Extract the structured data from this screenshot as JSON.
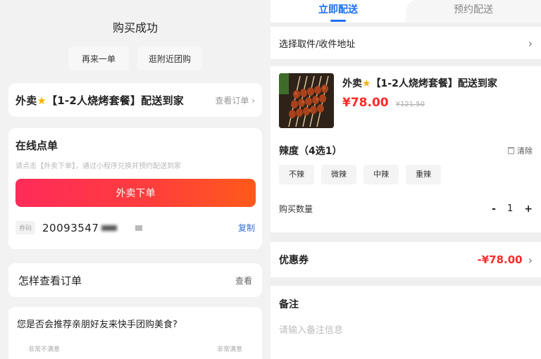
{
  "left": {
    "title": "购买成功",
    "buttons": {
      "again": "再来一单",
      "nearby": "逛附近团购"
    },
    "order": {
      "title_prefix": "外卖",
      "title_suffix": "【1-2人烧烤套餐】配送到家",
      "view_link": "查看订单 ›"
    },
    "online": {
      "title": "在线点单",
      "hint": "请点击【外卖下单】，通过小程序兑换并预约配送到家",
      "order_button": "外卖下单",
      "code_tag": "券码",
      "code_value": "20093547",
      "copy": "复制"
    },
    "howto": {
      "title": "怎样查看订单",
      "link": "查看"
    },
    "survey": {
      "question": "您是否会推荐亲朋好友来快手团购美食?",
      "low": "非常不满意",
      "high": "非常满意"
    }
  },
  "right": {
    "tabs": [
      "立即配送",
      "预约配送"
    ],
    "address": {
      "label": "选择取件/收件地址",
      "chevron": "›"
    },
    "product": {
      "name_prefix": "外卖",
      "name_suffix": "【1-2人烧烤套餐】配送到家",
      "price": "¥78.00",
      "original_price": "¥121.50"
    },
    "spice": {
      "title": "辣度（4选1）",
      "clear": "清除",
      "options": [
        "不辣",
        "微辣",
        "中辣",
        "重辣"
      ]
    },
    "quantity": {
      "label": "购买数量",
      "minus": "-",
      "value": "1",
      "plus": "+"
    },
    "coupon": {
      "label": "优惠券",
      "value": "-¥78.00",
      "chevron": "›"
    },
    "note": {
      "title": "备注",
      "placeholder": "请输入备注信息"
    }
  },
  "colors": {
    "accent_blue": "#1e6ff0",
    "price_red": "#ff2a2a",
    "order_button_gradient_start": "#ff2b5a",
    "order_button_gradient_end": "#ff5a1a",
    "star": "#f5b400"
  },
  "icons": {
    "star": "star-icon",
    "trash": "trash-icon",
    "chevron": "chevron-right-icon"
  }
}
